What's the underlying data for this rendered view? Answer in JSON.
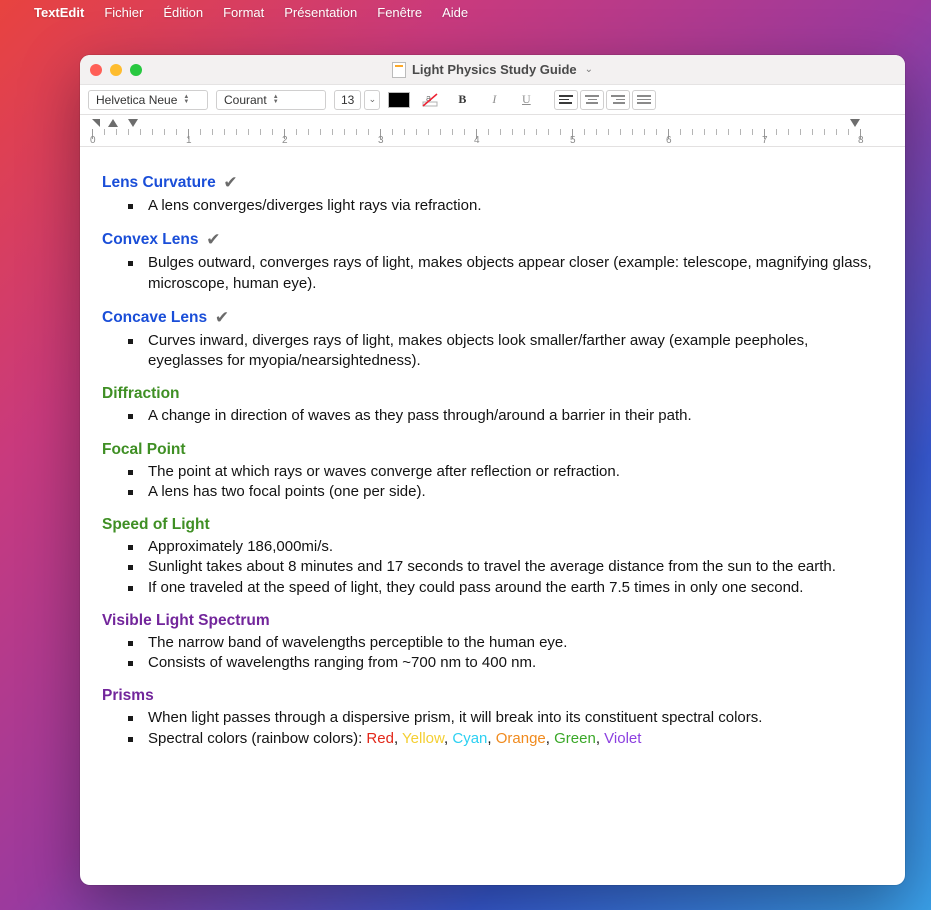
{
  "menubar": {
    "app": "TextEdit",
    "items": [
      "Fichier",
      "Édition",
      "Format",
      "Présentation",
      "Fenêtre",
      "Aide"
    ]
  },
  "window": {
    "title": "Light Physics Study Guide"
  },
  "toolbar": {
    "font_family": "Helvetica Neue",
    "style": "Courant",
    "size": "13",
    "bold": "B",
    "italic": "I",
    "underline": "U"
  },
  "ruler": {
    "labels": [
      "0",
      "1",
      "2",
      "3",
      "4",
      "5",
      "6",
      "7",
      "8"
    ]
  },
  "doc": {
    "sections": [
      {
        "title": "Lens Curvature",
        "color": "blue",
        "checked": true,
        "bullets": [
          "A lens converges/diverges light rays via refraction."
        ]
      },
      {
        "title": "Convex Lens",
        "color": "blue",
        "checked": true,
        "bullets": [
          "Bulges outward, converges rays of light, makes objects appear closer (example: telescope, magnifying glass, microscope, human eye)."
        ]
      },
      {
        "title": "Concave Lens",
        "color": "blue",
        "checked": true,
        "bullets": [
          "Curves inward, diverges rays of light, makes objects look smaller/farther away (example peepholes, eyeglasses for myopia/nearsightedness)."
        ]
      },
      {
        "title": "Diffraction",
        "color": "green",
        "checked": false,
        "bullets": [
          "A change in direction of waves as they pass through/around a barrier in their path."
        ]
      },
      {
        "title": "Focal Point",
        "color": "green",
        "checked": false,
        "bullets": [
          "The point at which rays or waves converge after reflection or refraction.",
          "A lens has two focal points (one per side)."
        ]
      },
      {
        "title": "Speed of Light",
        "color": "green",
        "checked": false,
        "bullets": [
          "Approximately 186,000mi/s.",
          "Sunlight takes about 8 minutes and 17 seconds to travel the average distance from the sun to the earth.",
          "If one traveled at the speed of light, they could pass around the earth 7.5 times in only one second."
        ]
      },
      {
        "title": "Visible Light Spectrum",
        "color": "purple",
        "checked": false,
        "bullets": [
          "The narrow band of wavelengths perceptible to the human eye.",
          "Consists of wavelengths ranging from ~700 nm to 400 nm."
        ]
      },
      {
        "title": "Prisms",
        "color": "purple",
        "checked": false,
        "bullets": [
          "When light passes through a dispersive prism, it will break into its constituent spectral colors."
        ],
        "spectral_prefix": "Spectral colors (rainbow colors): ",
        "spectral": [
          {
            "w": "Red",
            "c": "sp-red"
          },
          {
            "w": "Yellow",
            "c": "sp-yellow"
          },
          {
            "w": "Cyan",
            "c": "sp-cyan"
          },
          {
            "w": "Orange",
            "c": "sp-orange"
          },
          {
            "w": "Green",
            "c": "sp-green"
          },
          {
            "w": "Violet",
            "c": "sp-violet"
          }
        ]
      }
    ]
  }
}
